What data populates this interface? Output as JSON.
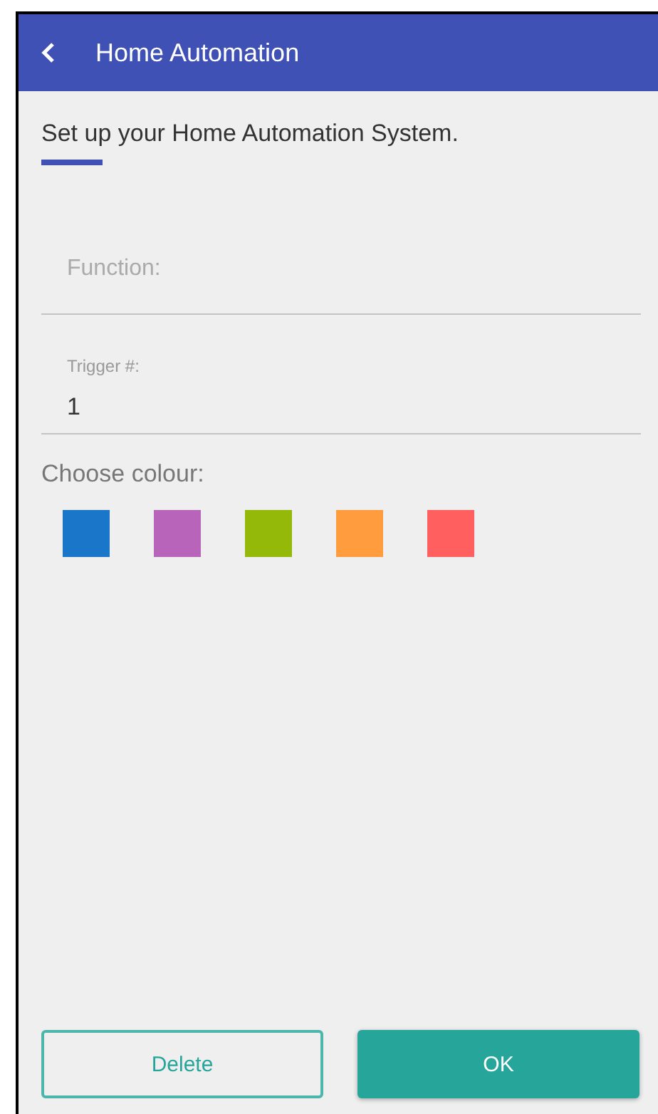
{
  "header": {
    "title": "Home Automation"
  },
  "intro": "Set up your Home Automation System.",
  "fields": [
    {
      "placeholder": "Function:",
      "kind": "placeholder"
    },
    {
      "label": "Trigger #:",
      "value": "1",
      "kind": "floating"
    }
  ],
  "colour_picker": {
    "label": "Choose colour:",
    "swatches": [
      {
        "color": "#1976c8"
      },
      {
        "color": "#b864ba"
      },
      {
        "color": "#95b908"
      },
      {
        "color": "#ff9d3e"
      },
      {
        "color": "#ff5f5f"
      }
    ]
  },
  "buttons": [
    {
      "label": "Delete",
      "kind": "outline"
    },
    {
      "label": "OK",
      "kind": "filled"
    }
  ]
}
